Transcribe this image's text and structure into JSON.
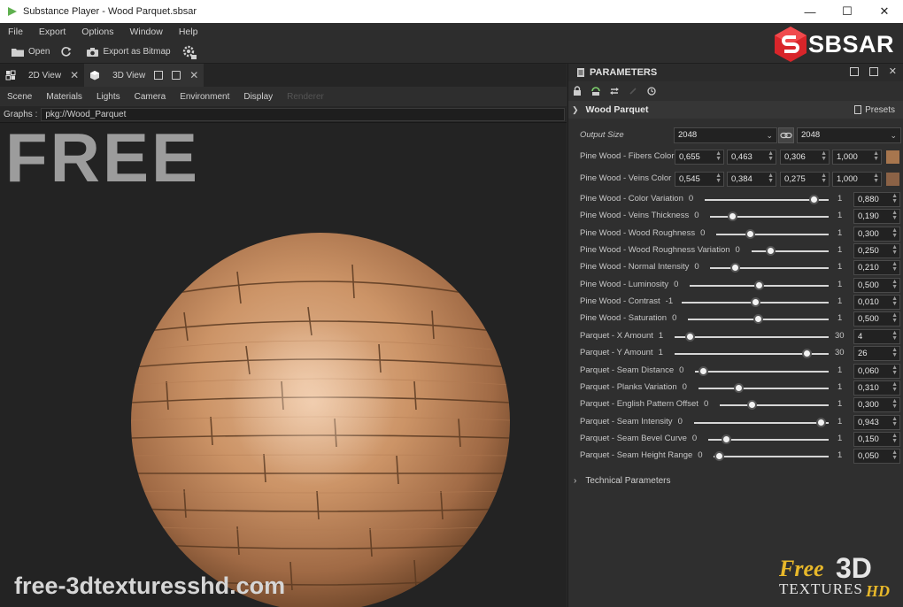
{
  "window": {
    "title": "Substance Player - Wood Parquet.sbsar",
    "minimize": "—",
    "maximize": "☐",
    "close": "✕"
  },
  "menu": [
    "File",
    "Export",
    "Options",
    "Window",
    "Help"
  ],
  "toolbar": {
    "open": "Open",
    "export_bitmap": "Export as Bitmap"
  },
  "logo": {
    "text": "SBSAR"
  },
  "tabs": [
    {
      "label": "2D View"
    },
    {
      "label": "3D View"
    }
  ],
  "view_menu": [
    "Scene",
    "Materials",
    "Lights",
    "Camera",
    "Environment",
    "Display",
    "Renderer"
  ],
  "graphs": {
    "label": "Graphs :",
    "path": "pkg://Wood_Parquet"
  },
  "viewport": {
    "overlay": "FREE",
    "watermark": "free-3dtexturesshd.com"
  },
  "panel": {
    "title": "PARAMETERS",
    "group": "Wood Parquet",
    "presets": "Presets",
    "output_size": {
      "label": "Output Size",
      "left": "2048",
      "right": "2048"
    },
    "colors": [
      {
        "label": "Pine Wood - Fibers Color",
        "values": [
          "0,655",
          "0,463",
          "0,306",
          "1,000"
        ],
        "swatch": "#a7764e"
      },
      {
        "label": "Pine Wood - Veins Color",
        "values": [
          "0,545",
          "0,384",
          "0,275",
          "1,000"
        ],
        "swatch": "#8b6246"
      }
    ],
    "sliders": [
      {
        "label": "Pine Wood - Color Variation",
        "min": "0",
        "max": "1",
        "value": "0,880",
        "frac": 0.88
      },
      {
        "label": "Pine Wood - Veins Thickness",
        "min": "0",
        "max": "1",
        "value": "0,190",
        "frac": 0.19
      },
      {
        "label": "Pine Wood - Wood Roughness",
        "min": "0",
        "max": "1",
        "value": "0,300",
        "frac": 0.3
      },
      {
        "label": "Pine Wood - Wood Roughness Variation",
        "min": "0",
        "max": "1",
        "value": "0,250",
        "frac": 0.25
      },
      {
        "label": "Pine Wood - Normal Intensity",
        "min": "0",
        "max": "1",
        "value": "0,210",
        "frac": 0.21
      },
      {
        "label": "Pine Wood - Luminosity",
        "min": "0",
        "max": "1",
        "value": "0,500",
        "frac": 0.5
      },
      {
        "label": "Pine Wood - Contrast",
        "min": "-1",
        "max": "1",
        "value": "0,010",
        "frac": 0.505
      },
      {
        "label": "Pine Wood - Saturation",
        "min": "0",
        "max": "1",
        "value": "0,500",
        "frac": 0.5
      },
      {
        "label": "Parquet - X Amount",
        "min": "1",
        "max": "30",
        "value": "4",
        "frac": 0.1
      },
      {
        "label": "Parquet - Y Amount",
        "min": "1",
        "max": "30",
        "value": "26",
        "frac": 0.86
      },
      {
        "label": "Parquet - Seam Distance",
        "min": "0",
        "max": "1",
        "value": "0,060",
        "frac": 0.06
      },
      {
        "label": "Parquet - Planks Variation",
        "min": "0",
        "max": "1",
        "value": "0,310",
        "frac": 0.31
      },
      {
        "label": "Parquet - English Pattern Offset",
        "min": "0",
        "max": "1",
        "value": "0,300",
        "frac": 0.3
      },
      {
        "label": "Parquet - Seam Intensity",
        "min": "0",
        "max": "1",
        "value": "0,943",
        "frac": 0.943
      },
      {
        "label": "Parquet - Seam Bevel Curve",
        "min": "0",
        "max": "1",
        "value": "0,150",
        "frac": 0.15
      },
      {
        "label": "Parquet - Seam Height Range",
        "min": "0",
        "max": "1",
        "value": "0,050",
        "frac": 0.05
      }
    ],
    "technical": "Technical Parameters"
  },
  "badge": {
    "free": "Free",
    "three_d": "3D",
    "textures": "TEXTURES",
    "hd": "HD"
  }
}
